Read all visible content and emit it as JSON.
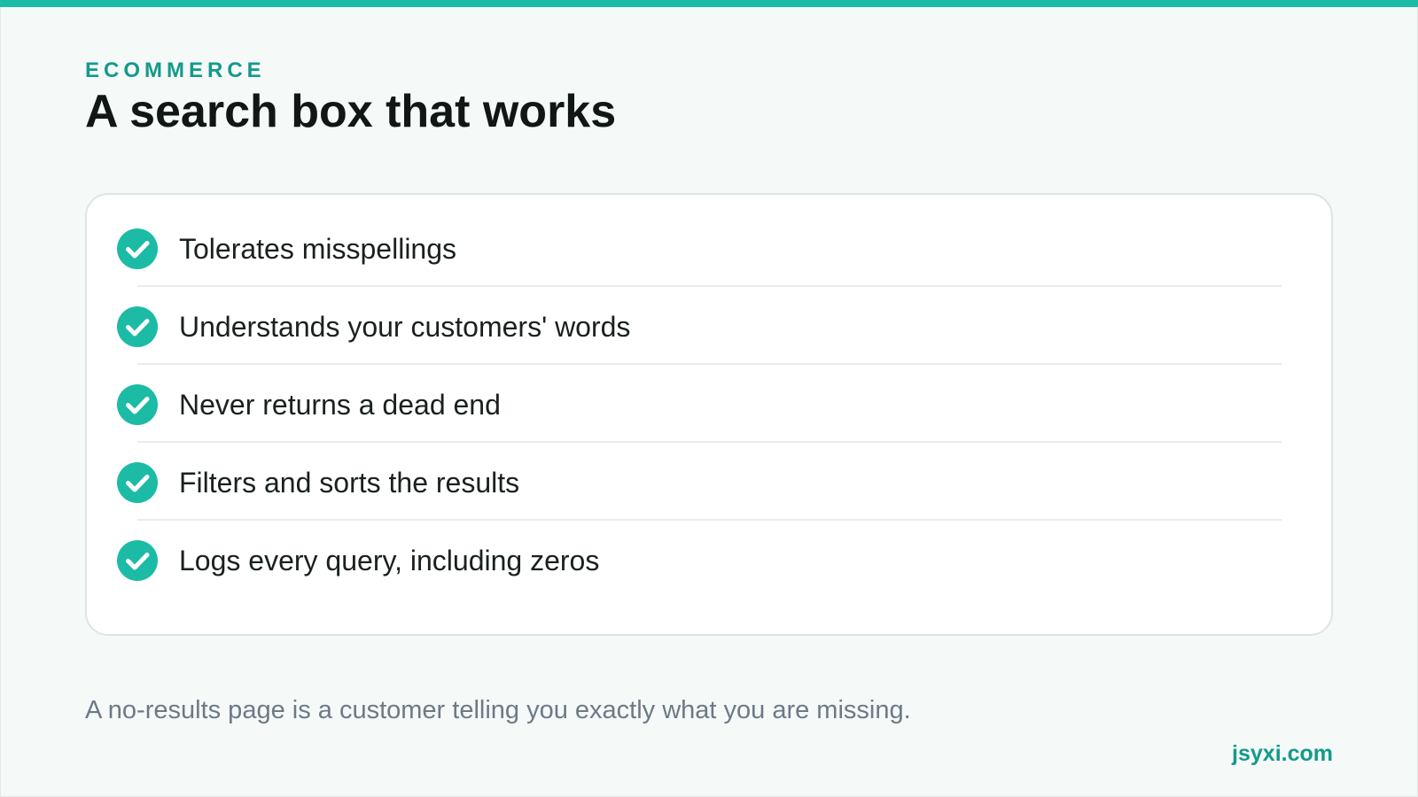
{
  "slide": {
    "eyebrow": "ECOMMERCE",
    "title": "A search box that works",
    "checklist": [
      {
        "label": "Tolerates misspellings",
        "icon": "check-circle-icon"
      },
      {
        "label": "Understands your customers' words",
        "icon": "check-circle-icon"
      },
      {
        "label": "Never returns a dead end",
        "icon": "check-circle-icon"
      },
      {
        "label": "Filters and sorts the results",
        "icon": "check-circle-icon"
      },
      {
        "label": "Logs every query, including zeros",
        "icon": "check-circle-icon"
      }
    ],
    "footnote": "A no-results page is a customer telling you exactly what you are missing.",
    "brand": "jsyxi.com"
  },
  "colors": {
    "accent": "#1cbba6",
    "accent_text": "#139a8b",
    "title": "#101714",
    "body_text": "#1a2020",
    "muted": "#6c7a86",
    "background": "#f5f9f8",
    "card": "#ffffff"
  }
}
